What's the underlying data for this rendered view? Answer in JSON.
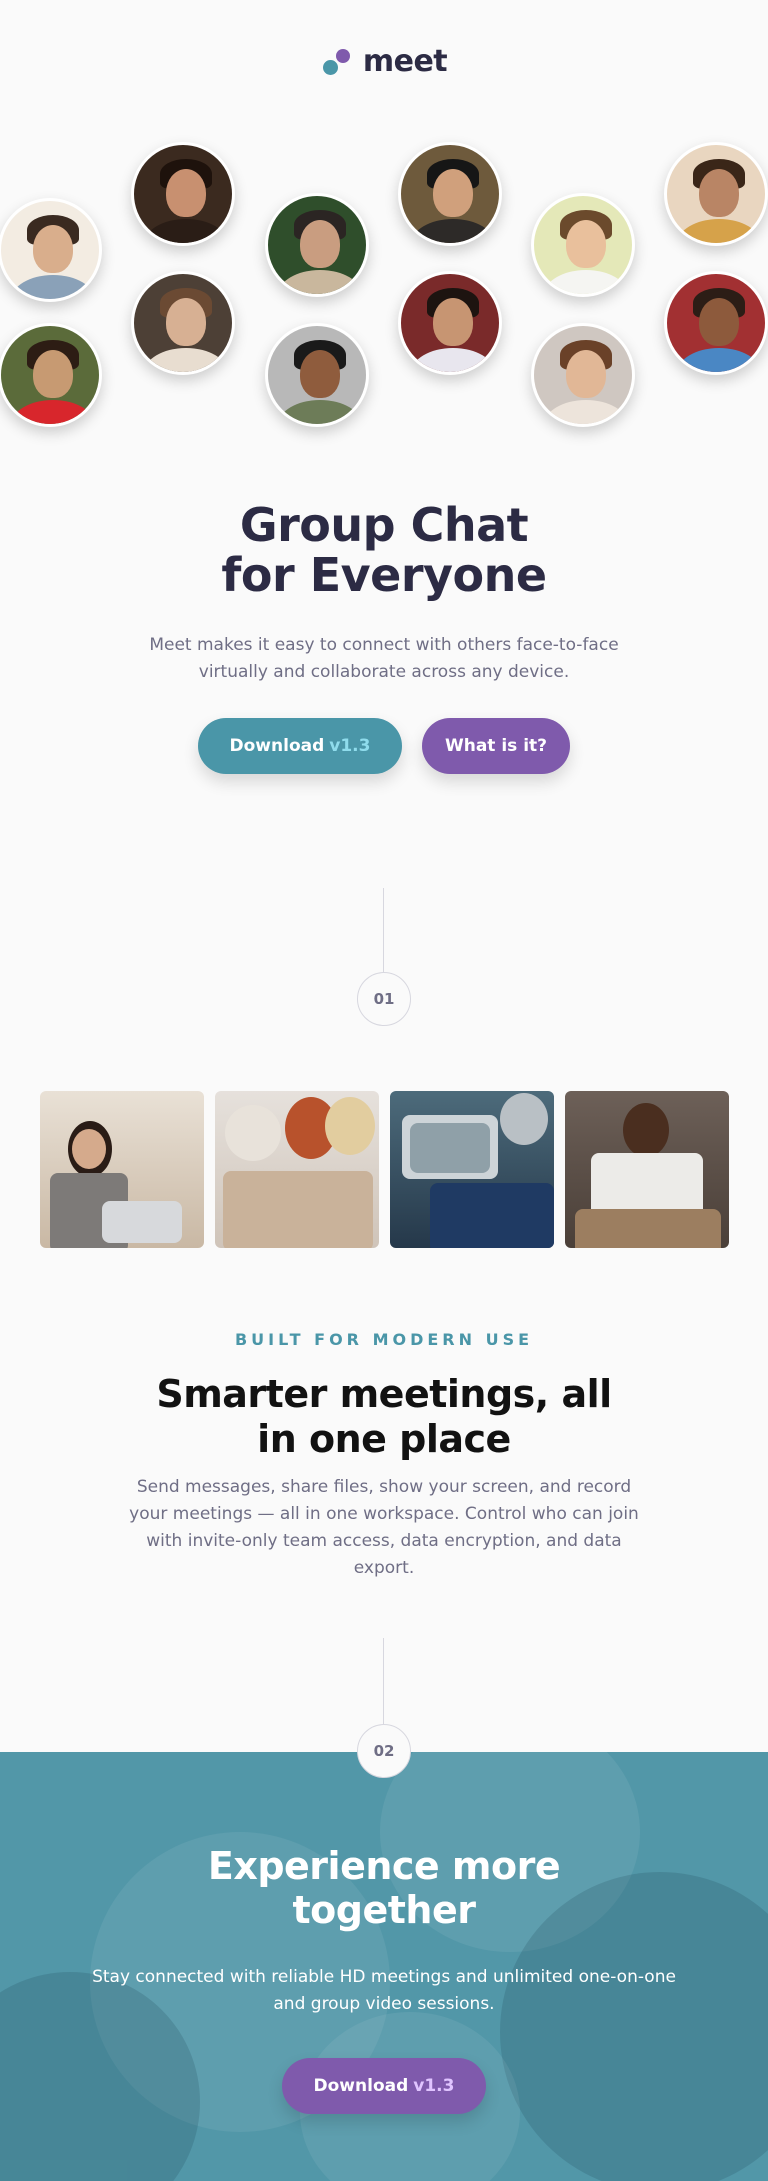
{
  "brand": {
    "name": "meet",
    "colors": {
      "teal": "#4a96a8",
      "purple": "#7f5aac",
      "dark": "#2c2b44"
    }
  },
  "avatars": [
    {
      "label": "avatar-1",
      "icon": "user-photo"
    },
    {
      "label": "avatar-2",
      "icon": "user-photo"
    },
    {
      "label": "avatar-3",
      "icon": "user-photo"
    },
    {
      "label": "avatar-4",
      "icon": "user-photo"
    },
    {
      "label": "avatar-5",
      "icon": "user-photo"
    },
    {
      "label": "avatar-6",
      "icon": "user-photo"
    },
    {
      "label": "avatar-7",
      "icon": "user-photo"
    },
    {
      "label": "avatar-8",
      "icon": "user-photo"
    },
    {
      "label": "avatar-9",
      "icon": "user-photo"
    },
    {
      "label": "avatar-10",
      "icon": "user-photo"
    },
    {
      "label": "avatar-11",
      "icon": "user-photo"
    },
    {
      "label": "avatar-12",
      "icon": "user-photo"
    }
  ],
  "hero": {
    "title_line1": "Group Chat",
    "title_line2": "for Everyone",
    "subtitle": "Meet makes it easy to connect with others face-to-face virtually and collaborate across any device.",
    "download_label": "Download",
    "version": "v1.3",
    "what_label": "What is it?"
  },
  "steps": {
    "one": "01",
    "two": "02"
  },
  "features": {
    "eyebrow": "BUILT FOR MODERN USE",
    "title_line1": "Smarter meetings, all",
    "title_line2": "in one place",
    "text": "Send messages, share files, show your screen, and record your meetings — all in one workspace. Control who can join with invite-only team access, data encryption, and data export."
  },
  "cta": {
    "title_line1": "Experience more",
    "title_line2": "together",
    "text": "Stay connected with reliable HD meetings and unlimited one-on-one and group video sessions.",
    "download_label": "Download",
    "version": "v1.3"
  }
}
